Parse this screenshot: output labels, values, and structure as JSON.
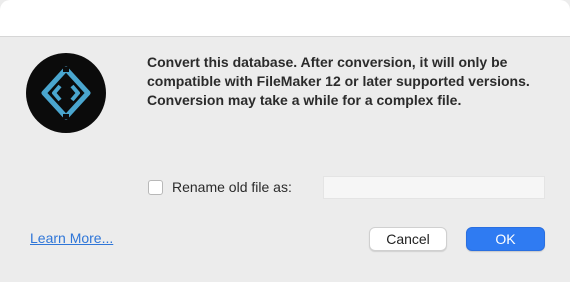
{
  "dialog": {
    "message": "Convert this database. After conversion, it will only be compatible with FileMaker 12 or later supported versions. Conversion may take a while for a complex file.",
    "app_icon": "filemaker-app-icon"
  },
  "rename": {
    "checked": false,
    "label": "Rename old file as:",
    "value": "",
    "placeholder": ""
  },
  "footer": {
    "learn_more_label": "Learn More...",
    "cancel_label": "Cancel",
    "ok_label": "OK"
  },
  "colors": {
    "accent": "#2f7bf2",
    "link": "#2f76d8",
    "background": "#ececec"
  }
}
